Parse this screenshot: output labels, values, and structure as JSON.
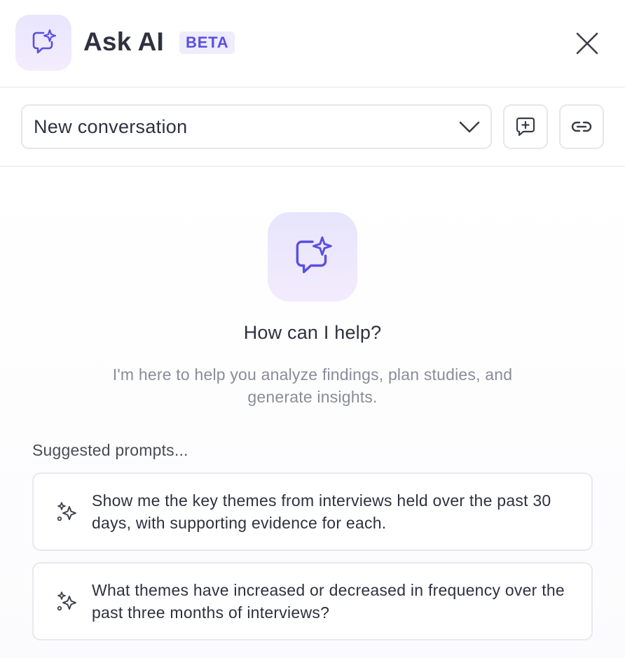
{
  "header": {
    "title": "Ask AI",
    "badge": "BETA",
    "logo_icon": "chat-sparkle-icon",
    "close_icon": "close-icon"
  },
  "toolbar": {
    "conversation_select": {
      "selected": "New conversation",
      "icon": "chevron-down-icon"
    },
    "new_chat_icon": "add-message-icon",
    "link_icon": "link-icon"
  },
  "main": {
    "hero_icon": "chat-sparkle-icon",
    "heading": "How can I help?",
    "subheading": "I'm here to help you analyze findings, plan studies, and generate insights.",
    "suggested_label": "Suggested prompts...",
    "prompts": [
      {
        "icon": "sparkles-icon",
        "text": "Show me the key themes from interviews held over the past 30 days, with supporting evidence for each."
      },
      {
        "icon": "sparkles-icon",
        "text": "What themes have increased or decreased in frequency over the past three months of interviews?"
      }
    ]
  },
  "colors": {
    "accent": "#5a4fe0",
    "badge_bg": "#eeecfd",
    "icon_tile_bg": "#e8e6fd",
    "border": "#e6e6ee",
    "muted_text": "#8a8c98"
  }
}
